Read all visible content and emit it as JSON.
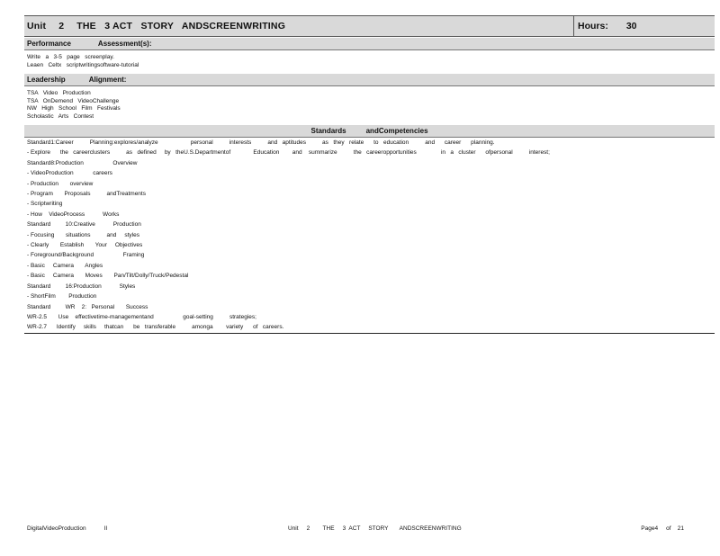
{
  "header": {
    "unit_label": "Unit",
    "unit_number": "2",
    "unit_title": "THE   3 ACT   STORY   ANDSCREENWRITING",
    "hours_label": "Hours:",
    "hours_value": "30"
  },
  "performance": {
    "label_a": "Performance",
    "label_b": "Assessment(s):",
    "lines": [
      "Write   a   3-5   page   screenplay.",
      "Leaen   Celtx   scriptwritingsoftware-tutorial"
    ]
  },
  "leadership": {
    "label_a": "Leadership",
    "label_b": "Alignment:",
    "lines": [
      "TSA   Video   Production",
      "TSA   OnDemend   VideoChallenge",
      "NW   High   School   Film   Festivals",
      "Scholastic   Arts   Contest"
    ]
  },
  "standards": {
    "label_a": "Standards",
    "label_b": "andCompetencies",
    "lines": [
      "Standard1:Career          Planning:explores/analyze                    personal          interests          and   aptitudes          as   they   relate      to   education          and      career      planning.",
      "- Explore      the   careerclusters          as   defined     by   theU.S.Departmentof              Education        and    summarize          the   careeropportunities               in   a   cluster      ofpersonal          interest;",
      "Standard8:Production                  Overview",
      "- VideoProduction            careers",
      "- Production       overview",
      "- Program       Proposals          andTreatments",
      "- Scriptwriting",
      "- How    VideoProcess           Works",
      "Standard         10:Creative           Production",
      "- Focusing       situations          and     styles",
      "- Clearly       Establish       Your     Objectives",
      "- Foreground/Background                  Framing",
      "- Basic     Camera       Angles",
      "- Basic     Camera       Moves       Pan/Tilt/Dolly/Truck/Pedestal",
      "Standard         16:Production           Styles",
      "- ShortFilm        Production",
      "Standard         WR    2:   Personal       Success",
      "WR-2.5       Use    effectivetime-managementand                  goal-setting          strategies;",
      "WR-2.7      Identify     skills     thatcan      be   transferable          amonga        variety      of   careers."
    ]
  },
  "footer": {
    "left": "DigitalVideoProduction           II",
    "center": "Unit     2        THE     3  ACT     STORY       ANDSCREENWRITING",
    "right": "Page4     of    21"
  }
}
